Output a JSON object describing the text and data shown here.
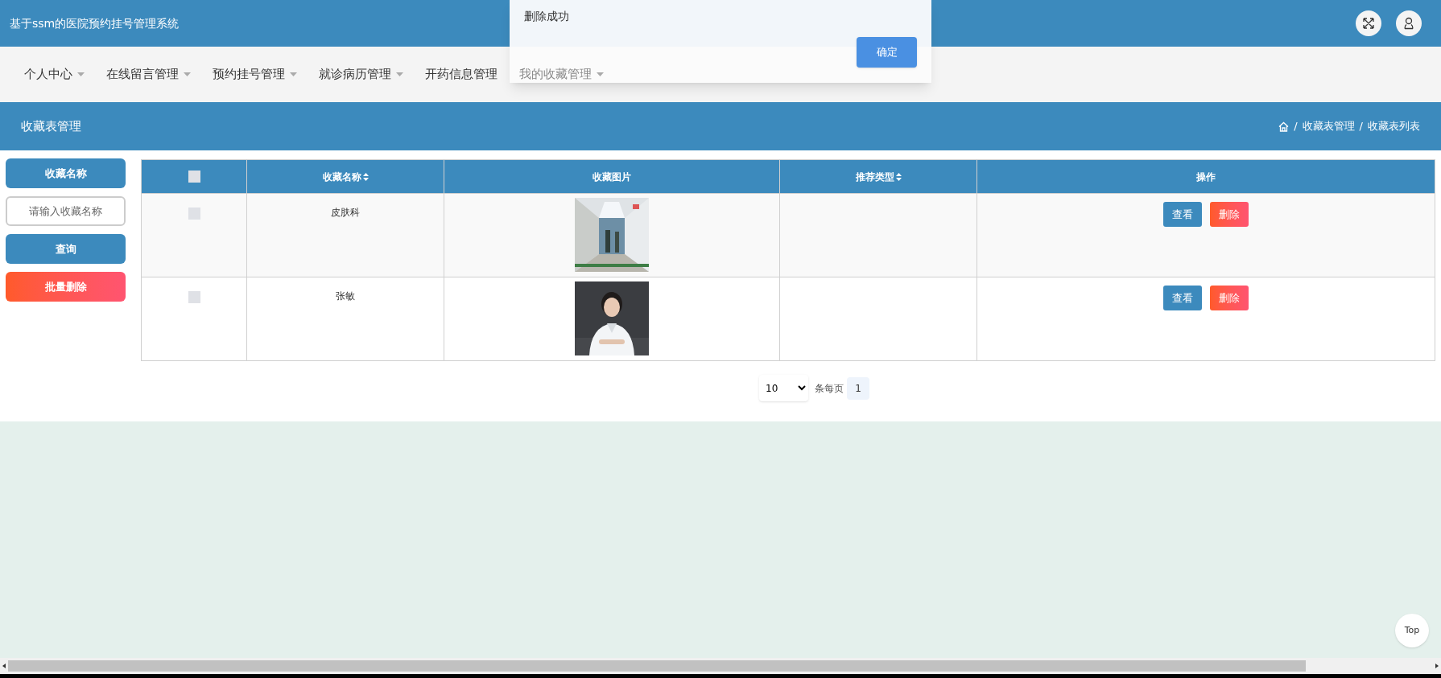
{
  "header": {
    "title": "基于ssm的医院预约挂号管理系统"
  },
  "nav": [
    {
      "label": "个人中心",
      "has_caret": true,
      "dimmed": false
    },
    {
      "label": "在线留言管理",
      "has_caret": true,
      "dimmed": false
    },
    {
      "label": "预约挂号管理",
      "has_caret": true,
      "dimmed": false
    },
    {
      "label": "就诊病历管理",
      "has_caret": true,
      "dimmed": false
    },
    {
      "label": "开药信息管理",
      "has_caret": false,
      "dimmed": false
    },
    {
      "label": "我的收藏管理",
      "has_caret": true,
      "dimmed": true
    }
  ],
  "dialog": {
    "message": "删除成功",
    "confirm": "确定"
  },
  "page_title": "收藏表管理",
  "breadcrumb": {
    "separator": "/",
    "items": [
      "收藏表管理",
      "收藏表列表"
    ]
  },
  "sidebar": {
    "label": "收藏名称",
    "placeholder": "请输入收藏名称",
    "search": "查询",
    "batch_delete": "批量删除"
  },
  "table": {
    "columns": [
      {
        "label": "收藏名称",
        "sortable": true
      },
      {
        "label": "收藏图片",
        "sortable": false
      },
      {
        "label": "推荐类型",
        "sortable": true
      },
      {
        "label": "操作",
        "sortable": false
      }
    ],
    "header_checked": false,
    "rows": [
      {
        "checked": false,
        "name": "皮肤科",
        "picture": {
          "kind": "corridor"
        },
        "actions": [
          "查看",
          "删除"
        ]
      },
      {
        "checked": false,
        "name": "张敏",
        "picture": {
          "kind": "portrait"
        },
        "actions": [
          "查看",
          "删除"
        ]
      }
    ]
  },
  "pagination": {
    "page_size": "10",
    "per_page_label": "条每页",
    "pages": [
      {
        "label": "1",
        "selected": true
      }
    ]
  },
  "top_button": "Top"
}
